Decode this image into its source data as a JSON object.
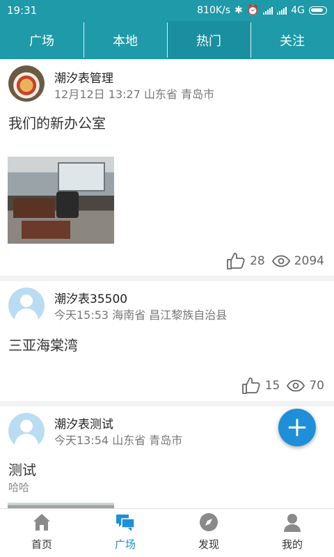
{
  "status_bar": {
    "time": "19:31",
    "speed": "810K/s",
    "network": "4G"
  },
  "top_tabs": [
    {
      "label": "广场"
    },
    {
      "label": "本地"
    },
    {
      "label": "热门"
    },
    {
      "label": "关注"
    }
  ],
  "posts": [
    {
      "username": "潮汐表管理",
      "meta": "12月12日 13:27 山东省 青岛市",
      "text": "我们的新办公室",
      "likes": "28",
      "views": "2094"
    },
    {
      "username": "潮汐表35500",
      "meta": "今天15:53 海南省 昌江黎族自治县",
      "text": "三亚海棠湾",
      "likes": "15",
      "views": "70"
    },
    {
      "username": "潮汐表测试",
      "meta": "今天13:54 山东省 青岛市",
      "text": "测试",
      "subtext": "哈哈"
    }
  ],
  "bottom_nav": [
    {
      "label": "首页",
      "icon": "home-icon"
    },
    {
      "label": "广场",
      "icon": "square-chat-icon"
    },
    {
      "label": "发现",
      "icon": "compass-icon"
    },
    {
      "label": "我的",
      "icon": "profile-icon"
    }
  ],
  "colors": {
    "header": "#1e9aa8",
    "accent": "#1e8fd8"
  }
}
